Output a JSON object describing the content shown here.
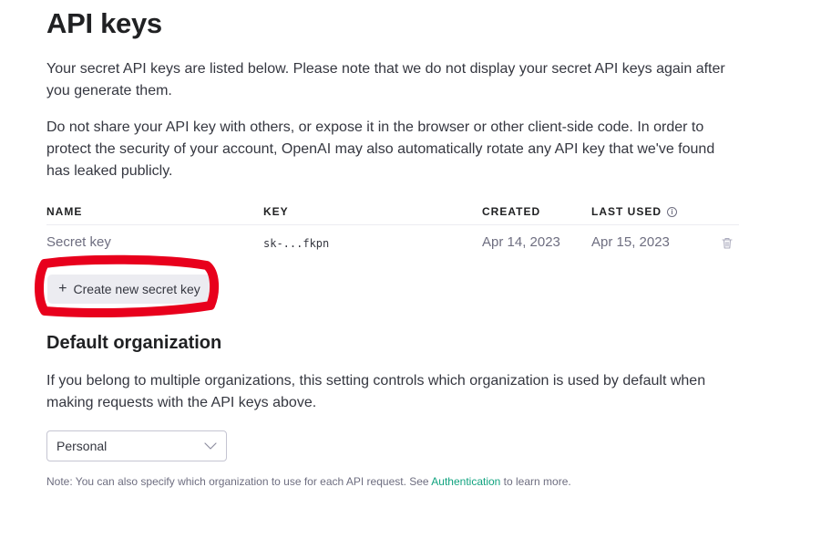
{
  "page": {
    "title": "API keys",
    "intro": "Your secret API keys are listed below. Please note that we do not display your secret API keys again after you generate them.",
    "warning": "Do not share your API key with others, or expose it in the browser or other client-side code. In order to protect the security of your account, OpenAI may also automatically rotate any API key that we've found has leaked publicly."
  },
  "table": {
    "headers": {
      "name": "NAME",
      "key": "KEY",
      "created": "CREATED",
      "last_used": "LAST USED"
    },
    "rows": [
      {
        "name": "Secret key",
        "key": "sk-...fkpn",
        "created": "Apr 14, 2023",
        "last_used": "Apr 15, 2023"
      }
    ]
  },
  "create_button": {
    "icon": "+",
    "label": "Create new secret key"
  },
  "default_org": {
    "heading": "Default organization",
    "description": "If you belong to multiple organizations, this setting controls which organization is used by default when making requests with the API keys above.",
    "selected": "Personal"
  },
  "note": {
    "before": "Note: You can also specify which organization to use for each API request. See ",
    "link": "Authentication",
    "after": " to learn more."
  },
  "colors": {
    "accent_link": "#10a37f",
    "annotation": "#e8001c",
    "button_bg": "#ececf1"
  },
  "icons": {
    "info": "info-icon",
    "delete": "trash-icon",
    "dropdown": "chevron-down-icon",
    "add": "plus-icon"
  }
}
